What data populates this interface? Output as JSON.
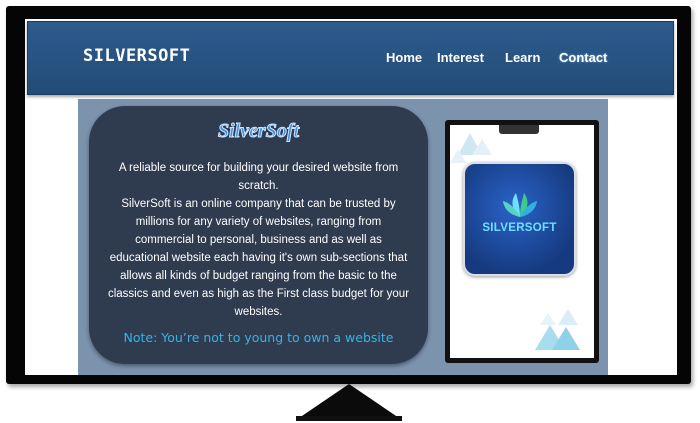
{
  "header": {
    "brand": "SILVERSOFT",
    "nav": [
      "Home",
      "Interest",
      "Learn",
      "Contact"
    ]
  },
  "card": {
    "title": "SilverSoft",
    "body": "A reliable source for building your desired website from scratch.\nSilverSoft  is an online company that can be trusted by millions for any variety of websites, ranging from commercial to personal, business and as well as educational website each having it's own sub-sections that allows all kinds of budget ranging from the basic to the classics and even as high as the First class budget for your websites.",
    "note": "Note: You’re not to young to own a website"
  },
  "phone": {
    "logo_text": "SILVERSOFT",
    "logo_icon": "lotus-icon"
  },
  "colors": {
    "header": "#2c5b8c",
    "content_bg": "#7c93ae",
    "card_bg": "#2f3b4f",
    "note": "#34b4e8",
    "logo_bg": "#1e4fa8"
  }
}
